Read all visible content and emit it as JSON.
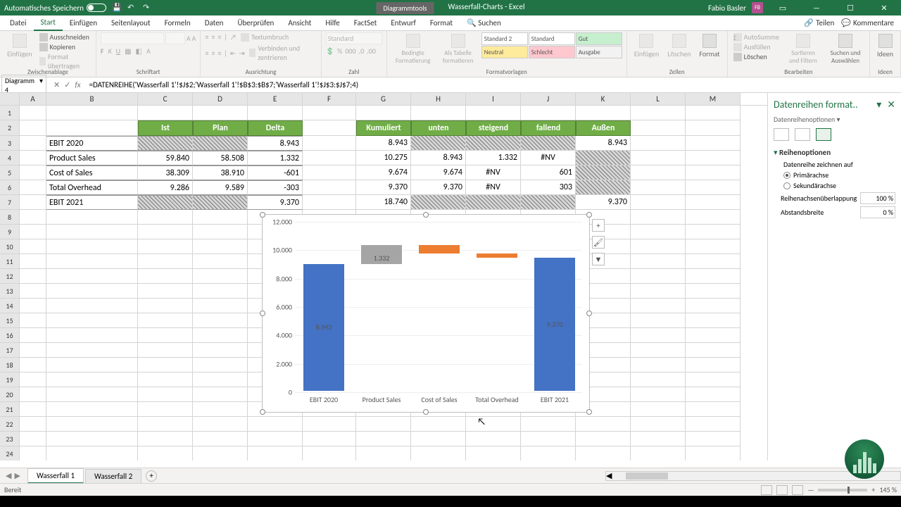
{
  "titlebar": {
    "autosave": "Automatisches Speichern",
    "diagram_tools": "Diagrammtools",
    "doc_title": "Wasserfall-Charts - Excel",
    "user": "Fabio Basler",
    "user_initials": "FB"
  },
  "tabs": {
    "datei": "Datei",
    "start": "Start",
    "einfuegen": "Einfügen",
    "seitenlayout": "Seitenlayout",
    "formeln": "Formeln",
    "daten": "Daten",
    "ueberpruefen": "Überprüfen",
    "ansicht": "Ansicht",
    "hilfe": "Hilfe",
    "factset": "FactSet",
    "entwurf": "Entwurf",
    "format": "Format",
    "suchen": "Suchen",
    "teilen": "Teilen",
    "kommentare": "Kommentare"
  },
  "ribbon": {
    "clipboard": {
      "label": "Zwischenablage",
      "paste": "Einfügen",
      "cut": "Ausschneiden",
      "copy": "Kopieren",
      "format_painter": "Format übertragen"
    },
    "font": {
      "label": "Schriftart"
    },
    "align": {
      "label": "Ausrichtung",
      "wrap": "Textumbruch",
      "merge": "Verbinden und zentrieren"
    },
    "number": {
      "label": "Zahl",
      "standard": "Standard"
    },
    "styles": {
      "label": "Formatvorlagen",
      "cond": "Bedingte Formatierung",
      "table": "Als Tabelle formatieren",
      "s1": "Standard 2",
      "s2": "Standard",
      "s3": "Gut",
      "s4": "Neutral",
      "s5": "Schlecht",
      "s6": "Ausgabe"
    },
    "cells": {
      "label": "Zellen",
      "insert": "Einfügen",
      "delete": "Löschen",
      "format": "Format"
    },
    "edit": {
      "label": "Bearbeiten",
      "sum": "AutoSumme",
      "fill": "Ausfüllen",
      "clear": "Löschen",
      "sort": "Sortieren und Filtern",
      "find": "Suchen und Auswählen"
    },
    "ideas": {
      "label": "Ideen",
      "btn": "Ideen"
    }
  },
  "formula_bar": {
    "name": "Diagramm 4",
    "formula": "=DATENREIHE('Wasserfall 1'!$J$2;'Wasserfall 1'!$B$3:$B$7;'Wasserfall 1'!$J$3:$J$7;4)"
  },
  "columns": [
    "A",
    "B",
    "C",
    "D",
    "E",
    "F",
    "G",
    "H",
    "I",
    "J",
    "K",
    "L",
    "M"
  ],
  "table1": {
    "headers": {
      "ist": "Ist",
      "plan": "Plan",
      "delta": "Delta"
    },
    "rows": [
      {
        "label": "EBIT 2020",
        "ist": "",
        "plan": "",
        "delta": "8.943"
      },
      {
        "label": "Product Sales",
        "ist": "59.840",
        "plan": "58.508",
        "delta": "1.332"
      },
      {
        "label": "Cost of Sales",
        "ist": "38.309",
        "plan": "38.910",
        "delta": "-601"
      },
      {
        "label": "Total Overhead",
        "ist": "9.286",
        "plan": "9.589",
        "delta": "-303"
      },
      {
        "label": "EBIT 2021",
        "ist": "",
        "plan": "",
        "delta": "9.370"
      }
    ]
  },
  "table2": {
    "headers": {
      "kumuliert": "Kumuliert",
      "unten": "unten",
      "steigend": "steigend",
      "fallend": "fallend",
      "aussen": "Außen"
    },
    "rows": [
      {
        "kumuliert": "8.943",
        "unten": "",
        "steigend": "",
        "fallend": "",
        "aussen": "8.943"
      },
      {
        "kumuliert": "10.275",
        "unten": "8.943",
        "steigend": "1.332",
        "fallend": "#NV",
        "aussen": ""
      },
      {
        "kumuliert": "9.674",
        "unten": "9.674",
        "steigend": "#NV",
        "fallend": "601",
        "aussen": ""
      },
      {
        "kumuliert": "9.370",
        "unten": "9.370",
        "steigend": "#NV",
        "fallend": "303",
        "aussen": ""
      },
      {
        "kumuliert": "18.740",
        "unten": "",
        "steigend": "",
        "fallend": "",
        "aussen": "9.370"
      }
    ]
  },
  "chart_data": {
    "type": "bar",
    "categories": [
      "EBIT 2020",
      "Product Sales",
      "Cost of Sales",
      "Total Overhead",
      "EBIT 2021"
    ],
    "series": [
      {
        "name": "unten",
        "values": [
          0,
          8943,
          9674,
          9370,
          0
        ]
      },
      {
        "name": "steigend",
        "values": [
          0,
          1332,
          0,
          0,
          0
        ]
      },
      {
        "name": "fallend",
        "values": [
          0,
          0,
          601,
          303,
          0
        ]
      },
      {
        "name": "Außen",
        "values": [
          8943,
          0,
          0,
          0,
          9370
        ]
      }
    ],
    "yticks": [
      "0",
      "2.000",
      "4.000",
      "6.000",
      "8.000",
      "10.000",
      "12.000"
    ],
    "ylim": [
      0,
      12000
    ],
    "data_labels": {
      "ebit2020": "8.943",
      "product_sales": "1.332",
      "ebit2021": "9.370"
    }
  },
  "taskpane": {
    "title": "Datenreihen format..",
    "options_label": "Datenreihenoptionen",
    "section": "Reihenoptionen",
    "draw_on": "Datenreihe zeichnen auf",
    "primary": "Primärachse",
    "secondary": "Sekundärachse",
    "overlap_label": "Reihenachsenüberlappung",
    "overlap_value": "100 %",
    "gap_label": "Abstandsbreite",
    "gap_value": "0 %"
  },
  "sheets": {
    "s1": "Wasserfall 1",
    "s2": "Wasserfall 2"
  },
  "statusbar": {
    "ready": "Bereit",
    "zoom": "145 %"
  }
}
